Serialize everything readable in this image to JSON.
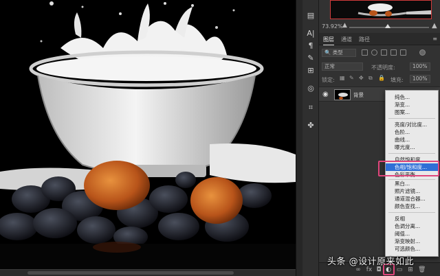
{
  "navigator": {
    "zoom": "73.92%"
  },
  "layers_panel": {
    "tabs": [
      {
        "label": "图层",
        "active": true
      },
      {
        "label": "通道",
        "active": false
      },
      {
        "label": "路径",
        "active": false
      }
    ],
    "filter_kind": "类型",
    "blend_mode": "正常",
    "opacity_label": "不透明度:",
    "opacity_value": "100%",
    "lock_label": "锁定:",
    "fill_label": "填充:",
    "fill_value": "100%",
    "layers": [
      {
        "name": "背景",
        "visible": true
      }
    ]
  },
  "adjustment_menu": {
    "groups": [
      [
        "纯色...",
        "渐变...",
        "图案..."
      ],
      [
        "亮度/对比度...",
        "色阶...",
        "曲线...",
        "曝光度..."
      ],
      [
        "自然饱和度...",
        "色相/饱和度...",
        "色彩平衡..."
      ],
      [
        "黑白...",
        "照片滤镜...",
        "通道混合器...",
        "颜色查找..."
      ],
      [
        "反相",
        "色调分离...",
        "阈值...",
        "渐变映射...",
        "可选颜色..."
      ]
    ],
    "selected": "色相/饱和度..."
  },
  "watermark": "头条 @设计原来如此",
  "colors": {
    "highlight": "#e0457b",
    "menu_selected": "#2f6fd6"
  },
  "icons": [
    "eye-icon",
    "crop-icon",
    "adjustment-layer-icon",
    "panel-menu-icon"
  ]
}
